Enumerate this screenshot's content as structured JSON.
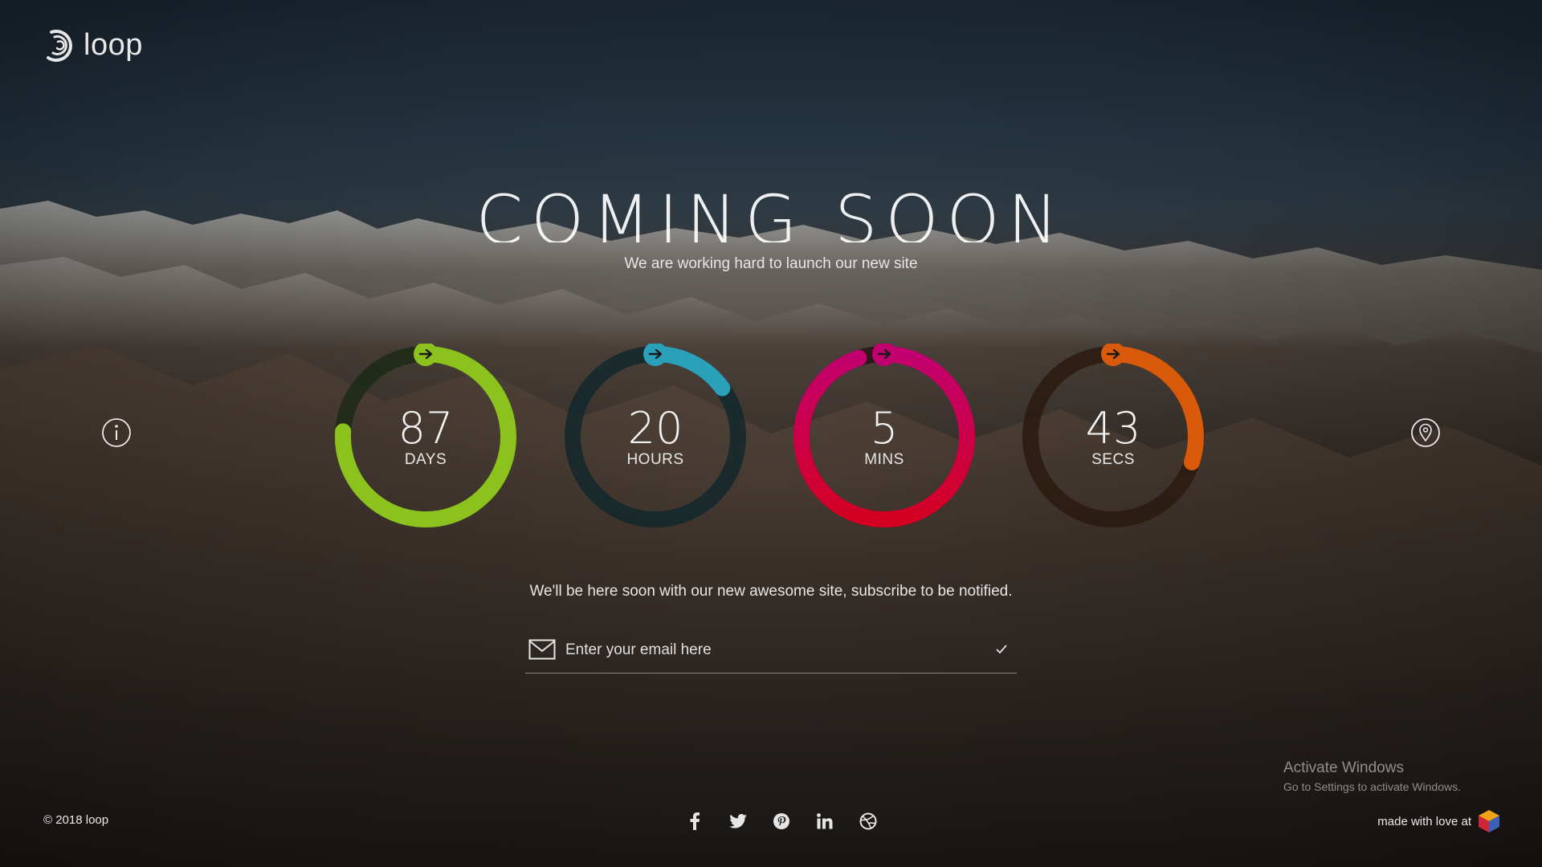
{
  "brand": {
    "name": "loop"
  },
  "hero": {
    "title": "COMING SOON",
    "subtitle": "We are working hard to launch our new site"
  },
  "countdown": [
    {
      "value": "87",
      "unit": "DAYS",
      "color": "#8cc21d",
      "track": "#1c2a14",
      "progress": 0.76
    },
    {
      "value": "20",
      "unit": "HOURS",
      "color": "#2aa1b9",
      "track": "#13282b",
      "progress": 0.15
    },
    {
      "value": "5",
      "unit": "MINS",
      "color": "#c2006f",
      "color2": "#d40022",
      "track": "#2a1018",
      "progress": 0.95
    },
    {
      "value": "43",
      "unit": "SECS",
      "color": "#d85a0a",
      "track": "#2a1a0e",
      "progress": 0.3
    }
  ],
  "notify": {
    "text": "We'll be here soon with our new awesome site, subscribe to be notified.",
    "email_placeholder": "Enter your email here"
  },
  "side_icons": {
    "left": "info-icon",
    "right": "location-pin-icon"
  },
  "windows_watermark": {
    "title": "Activate Windows",
    "detail": "Go to Settings to activate Windows."
  },
  "footer": {
    "copyright": "© 2018 loop",
    "social": [
      "facebook-icon",
      "twitter-icon",
      "pinterest-icon",
      "linkedin-icon",
      "dribbble-icon"
    ],
    "made_with": "made with love at"
  }
}
